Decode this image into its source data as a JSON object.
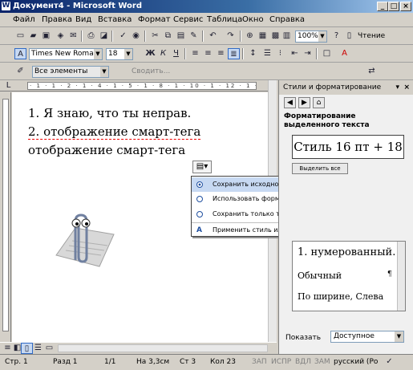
{
  "window": {
    "title": "Документ4 - Microsoft Word",
    "app_icon": "W",
    "min": "_",
    "max": "□",
    "close": "×"
  },
  "menu": [
    "Файл",
    "Правка",
    "Вид",
    "Вставка",
    "Формат",
    "Сервис",
    "Таблица",
    "Окно",
    "Справка"
  ],
  "toolbar_std": {
    "zoom": "100%",
    "reading": "Чтение"
  },
  "toolbar_fmt": {
    "style_glyph": "A",
    "font": "Times New Roman",
    "size": "18",
    "bold": "Ж",
    "italic": "К",
    "underline": "Ч"
  },
  "toolbar_review": {
    "display": "Все элементы",
    "show": "Сводить..."
  },
  "document": {
    "line1": "1.  Я знаю, что ты неправ.",
    "line2": "2.  отображение смарт-тега",
    "line3": "отображение смарт-тега"
  },
  "ruler": {
    "marks": "· 1 · 1 · 2 · 1 · 4 · 1 · 5 · 1 · 8 · 1 · 10 · 1 · 12 · 1 · 14"
  },
  "smart_tag_menu": {
    "items": [
      "Сохранить исходное форматирование",
      "Использовать форматирование конечного фрагмента",
      "Сохранить только текст",
      "Применить стиль или форматирование..."
    ],
    "selected_index": 0
  },
  "task_pane": {
    "title": "Стили и форматирование",
    "close": "×",
    "section": "Форматирование выделенного текста",
    "style_box": "Стиль 16 пт + 18",
    "select_all": "Выделить все",
    "list": [
      "1.   нумерованный.",
      "Обычный",
      "По ширине, Слева"
    ],
    "list_mark": "¶",
    "show_label": "Показать",
    "show_value": "Доступное"
  },
  "statusbar": {
    "page": "Стр. 1",
    "section": "Разд 1",
    "pages": "1/1",
    "at": "На 3,3см",
    "line": "Ст 3",
    "col": "Кол 23",
    "rec": "ЗАП",
    "trk": "ИСПР",
    "ext": "ВДЛ",
    "ovr": "ЗАМ",
    "lang": "русский (Ро"
  }
}
